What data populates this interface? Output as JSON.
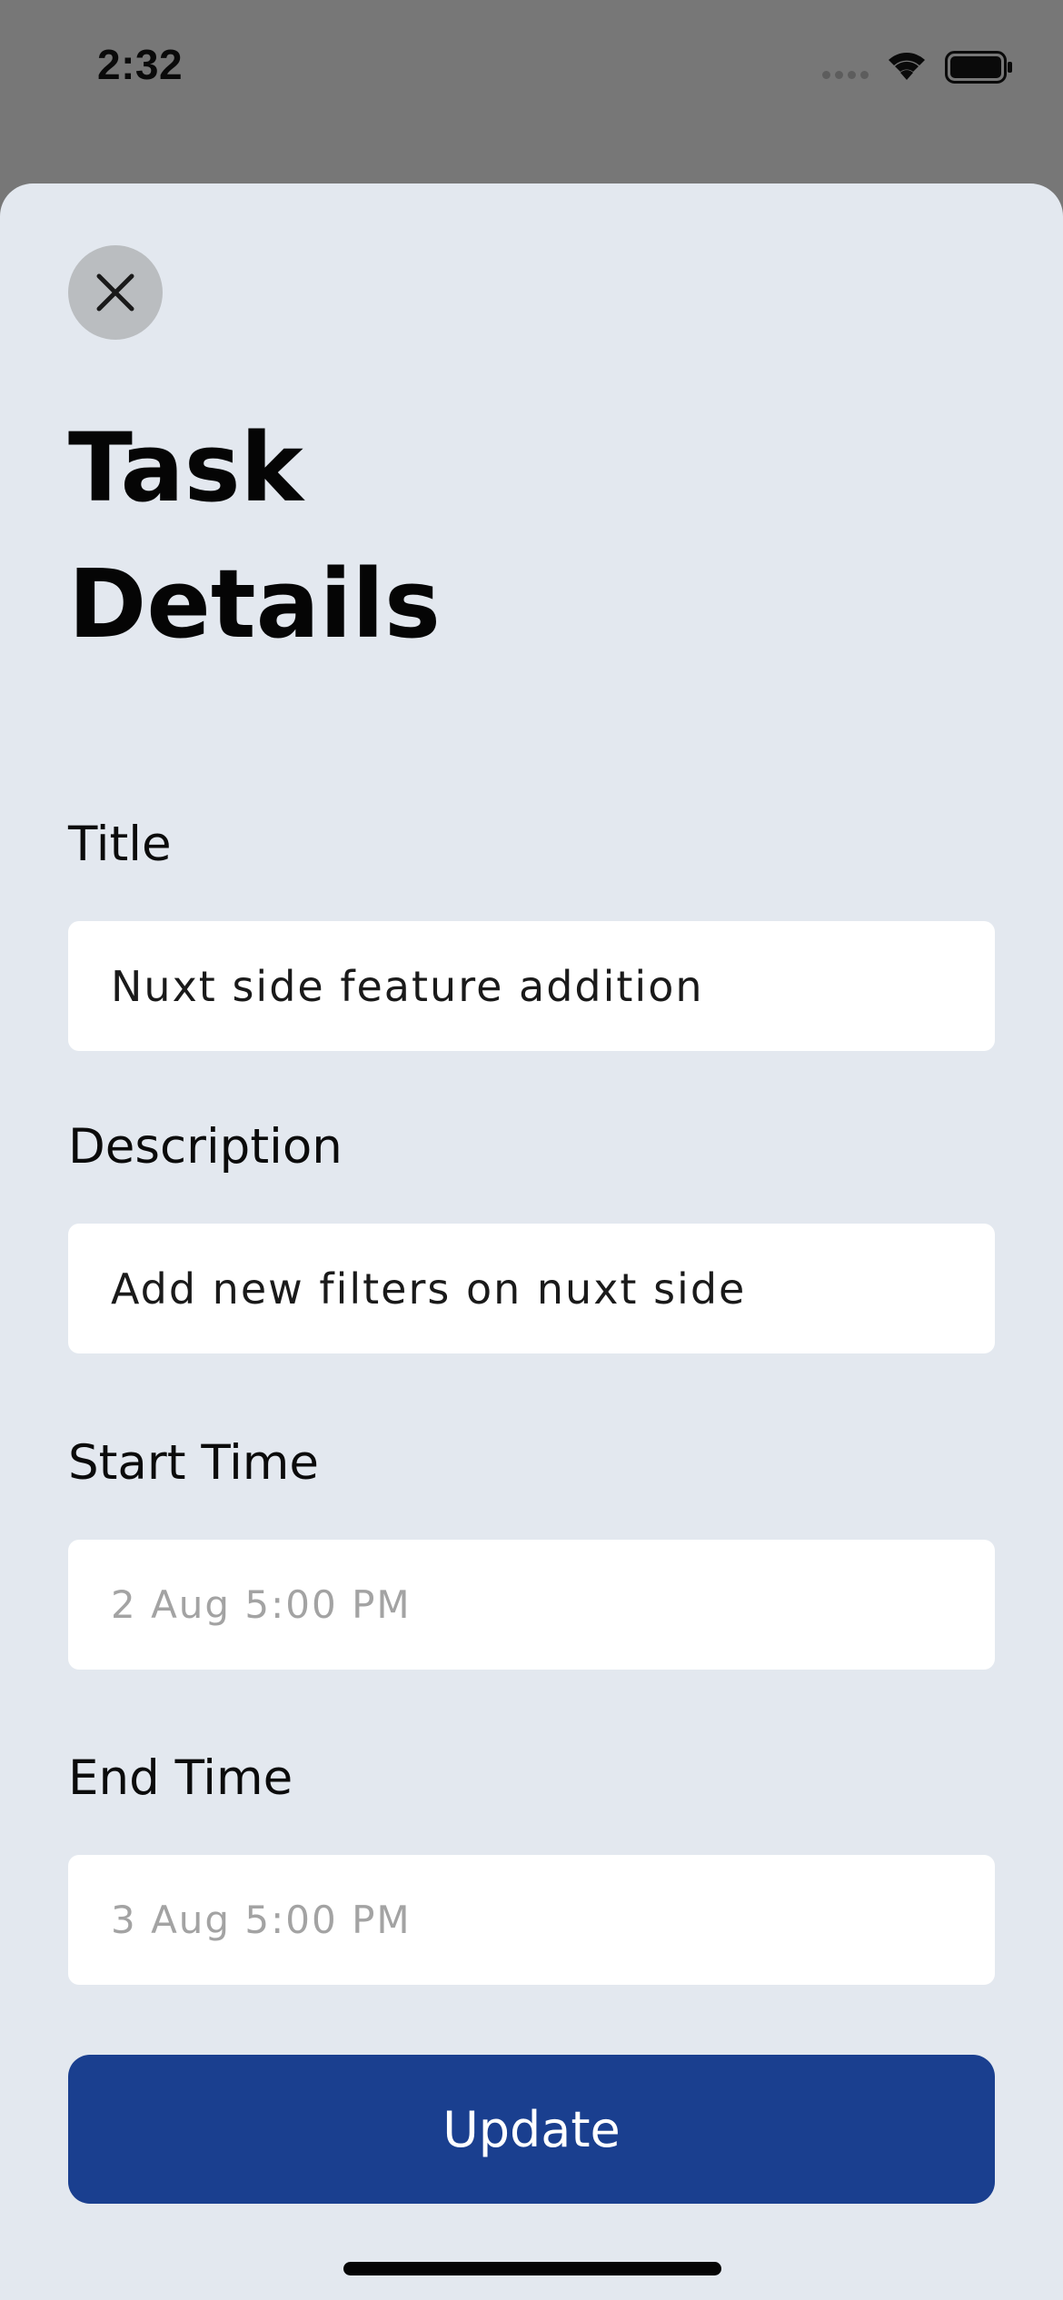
{
  "status_bar": {
    "time": "2:32"
  },
  "page": {
    "title_line1": "Task",
    "title_line2": "Details"
  },
  "fields": {
    "title": {
      "label": "Title",
      "value": "Nuxt side feature addition"
    },
    "description": {
      "label": "Description",
      "value": "Add new filters on nuxt side"
    },
    "start_time": {
      "label": "Start Time",
      "placeholder": "2 Aug 5:00 PM"
    },
    "end_time": {
      "label": "End Time",
      "placeholder": "3 Aug 5:00 PM"
    }
  },
  "actions": {
    "update_label": "Update"
  },
  "icons": {
    "close": "close-icon",
    "wifi": "wifi-icon",
    "battery": "battery-icon",
    "signal": "signal-icon"
  },
  "colors": {
    "backdrop": "#777777",
    "sheet_background": "#e3e8ef",
    "close_circle": "#babdc0",
    "primary_button": "#1a3f8f",
    "field_background": "#ffffff",
    "placeholder_text": "#a3a3a3"
  }
}
